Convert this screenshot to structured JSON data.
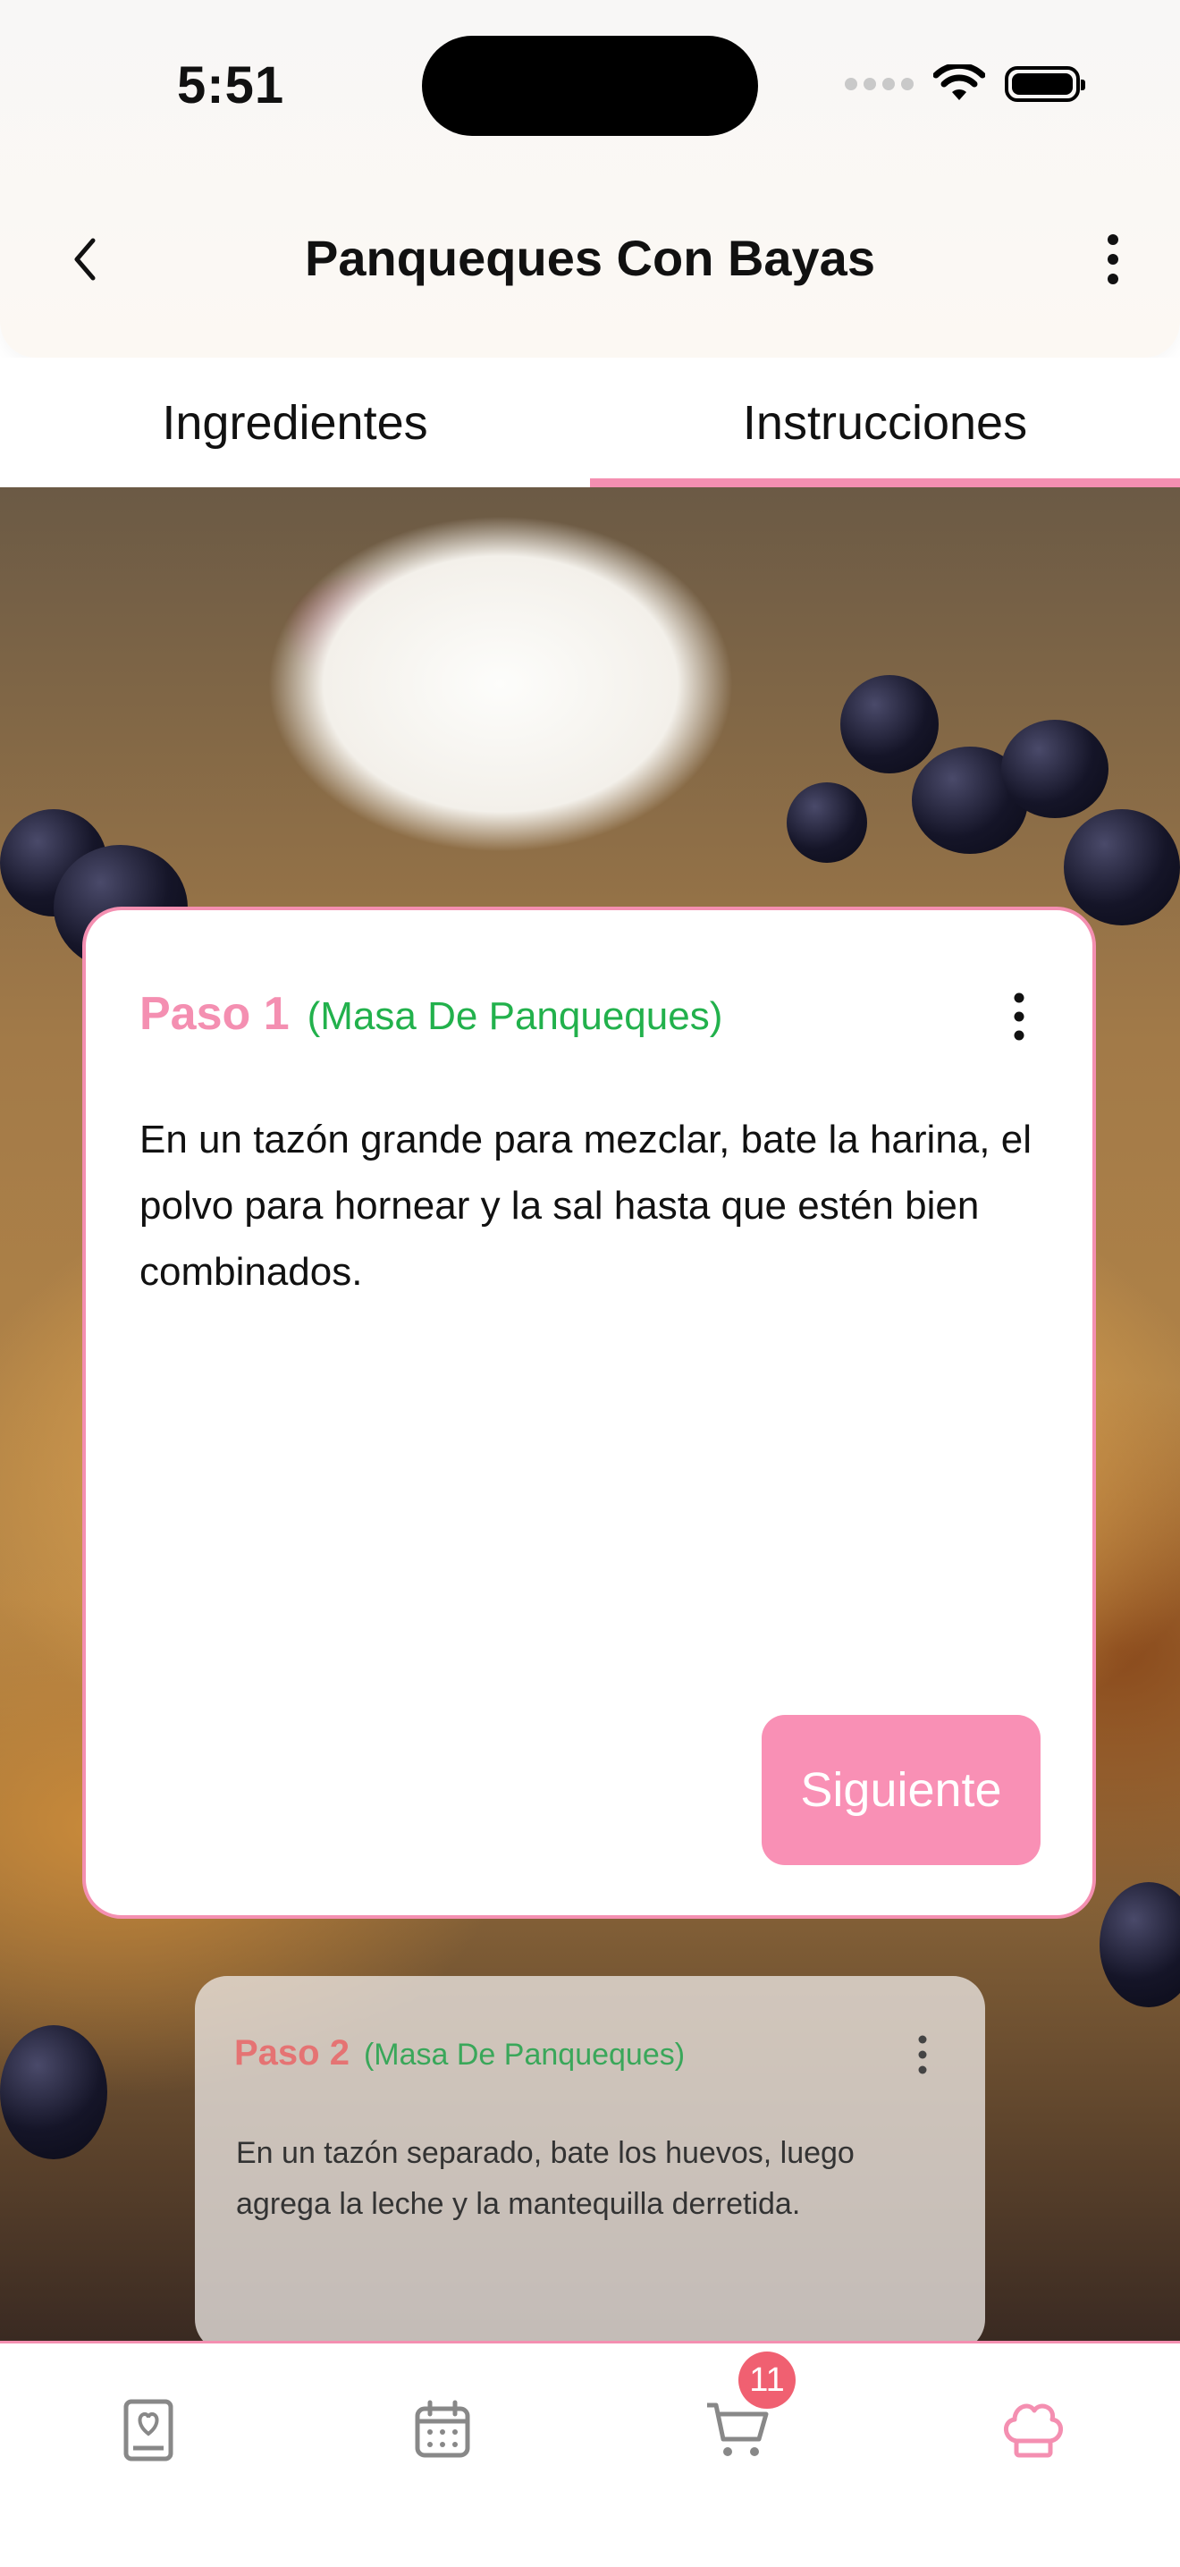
{
  "status_bar": {
    "time": "5:51"
  },
  "header": {
    "title": "Panqueques Con Bayas"
  },
  "tabs": [
    {
      "label": "Ingredientes",
      "active": false
    },
    {
      "label": "Instrucciones",
      "active": true
    }
  ],
  "steps": [
    {
      "number_label": "Paso 1",
      "group_label": "(Masa De Panqueques)",
      "text": "En un tazón grande para mezclar, bate la harina, el polvo para hornear y la sal hasta que estén bien combinados.",
      "next_label": "Siguiente"
    },
    {
      "number_label": "Paso 2",
      "group_label": "(Masa De Panqueques)",
      "text": "En un tazón separado, bate los huevos, luego agrega la leche y la mantequilla derretida."
    }
  ],
  "bottom_nav": {
    "items": [
      {
        "icon": "recipe-book-icon",
        "active": false
      },
      {
        "icon": "calendar-icon",
        "active": false
      },
      {
        "icon": "cart-icon",
        "active": false,
        "badge": "11"
      },
      {
        "icon": "chef-hat-icon",
        "active": true
      }
    ]
  },
  "colors": {
    "accent": "#f48fb1",
    "button": "#f990b5",
    "green": "#22b14c",
    "badge": "#f06071"
  }
}
